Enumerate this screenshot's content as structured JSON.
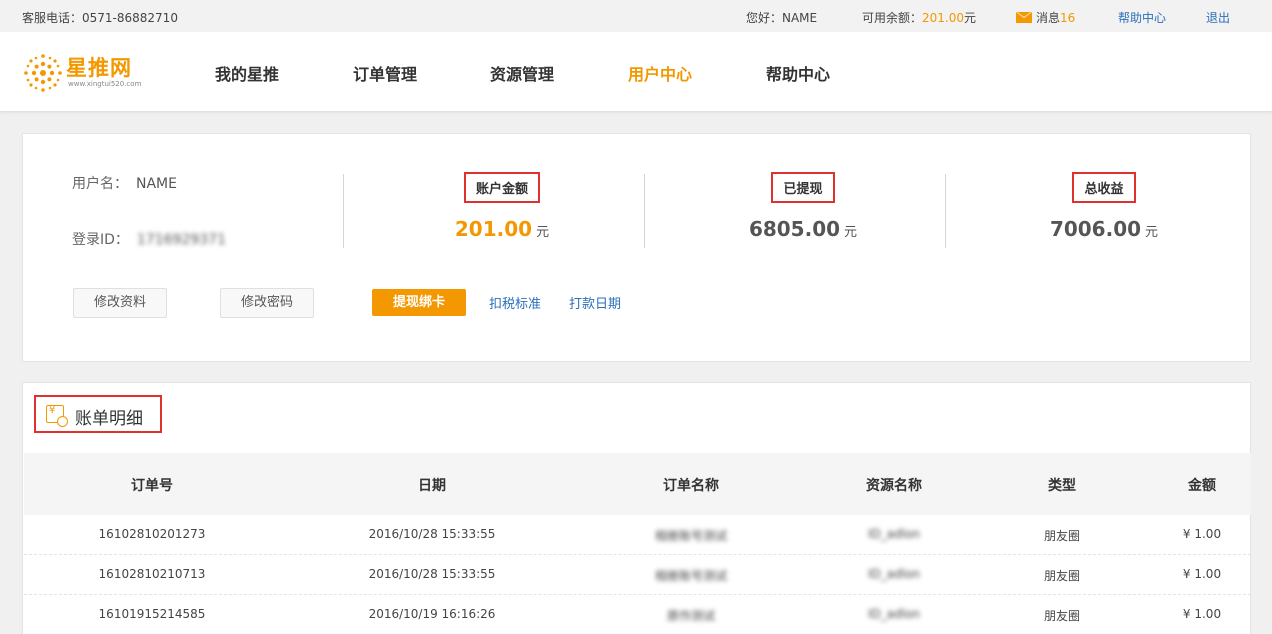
{
  "topbar": {
    "hotline": "客服电话：0571-86882710",
    "greeting": "您好：NAME",
    "balance_label": "可用余额：",
    "balance_value": "201.00",
    "balance_unit": "元",
    "messages_label": "消息",
    "messages_count": "16",
    "help": "帮助中心",
    "logout": "退出",
    "accent_color": "#f39800",
    "link_color": "#2a6fb8"
  },
  "logo": {
    "brand": "星推网",
    "url": "www.xingtui520.com"
  },
  "nav": [
    {
      "label": "我的星推",
      "active": false
    },
    {
      "label": "订单管理",
      "active": false
    },
    {
      "label": "资源管理",
      "active": false
    },
    {
      "label": "用户中心",
      "active": true
    },
    {
      "label": "帮助中心",
      "active": false
    }
  ],
  "account": {
    "username_label": "用户名：",
    "username": "NAME",
    "login_id_label": "登录ID：",
    "login_id": "1716929371",
    "stats": [
      {
        "label": "账户金额",
        "amount": "201.00",
        "unit": "元"
      },
      {
        "label": "已提现",
        "amount": "6805.00",
        "unit": "元"
      },
      {
        "label": "总收益",
        "amount": "7006.00",
        "unit": "元"
      }
    ],
    "buttons": {
      "edit_profile": "修改资料",
      "change_password": "修改密码",
      "withdraw_bind": "提现绑卡"
    },
    "links": {
      "tax_standard": "扣税标准",
      "payment_date": "打款日期"
    }
  },
  "bill": {
    "title": "账单明细",
    "columns": [
      "订单号",
      "日期",
      "订单名称",
      "资源名称",
      "类型",
      "金额"
    ],
    "rows": [
      [
        "16102810201273",
        "2016/10/28 15:33:55",
        "相册账号测试",
        "ID_adlon",
        "朋友圈",
        "¥ 1.00"
      ],
      [
        "16102810210713",
        "2016/10/28 15:33:55",
        "相册账号测试",
        "ID_adlon",
        "朋友圈",
        "¥ 1.00"
      ],
      [
        "16101915214585",
        "2016/10/19 16:16:26",
        "原作测试",
        "ID_adlon",
        "朋友圈",
        "¥ 1.00"
      ]
    ]
  }
}
